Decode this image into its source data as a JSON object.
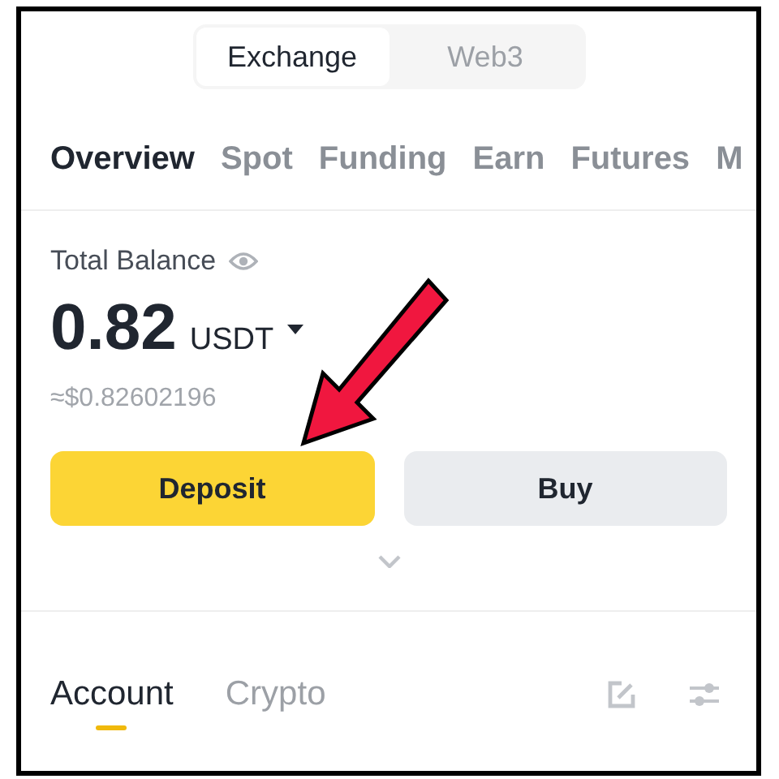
{
  "segments": [
    {
      "label": "Exchange",
      "selected": true
    },
    {
      "label": "Web3",
      "selected": false
    }
  ],
  "tabs": [
    {
      "label": "Overview",
      "selected": true
    },
    {
      "label": "Spot",
      "selected": false
    },
    {
      "label": "Funding",
      "selected": false
    },
    {
      "label": "Earn",
      "selected": false
    },
    {
      "label": "Futures",
      "selected": false
    },
    {
      "label": "M",
      "selected": false
    }
  ],
  "balance": {
    "label": "Total Balance",
    "amount": "0.82",
    "currency": "USDT",
    "approx": "≈$0.82602196"
  },
  "buttons": [
    {
      "label": "Deposit",
      "kind": "primary"
    },
    {
      "label": "Buy",
      "kind": "secondary"
    }
  ],
  "sub_tabs": [
    {
      "label": "Account",
      "selected": true
    },
    {
      "label": "Crypto",
      "selected": false
    }
  ]
}
